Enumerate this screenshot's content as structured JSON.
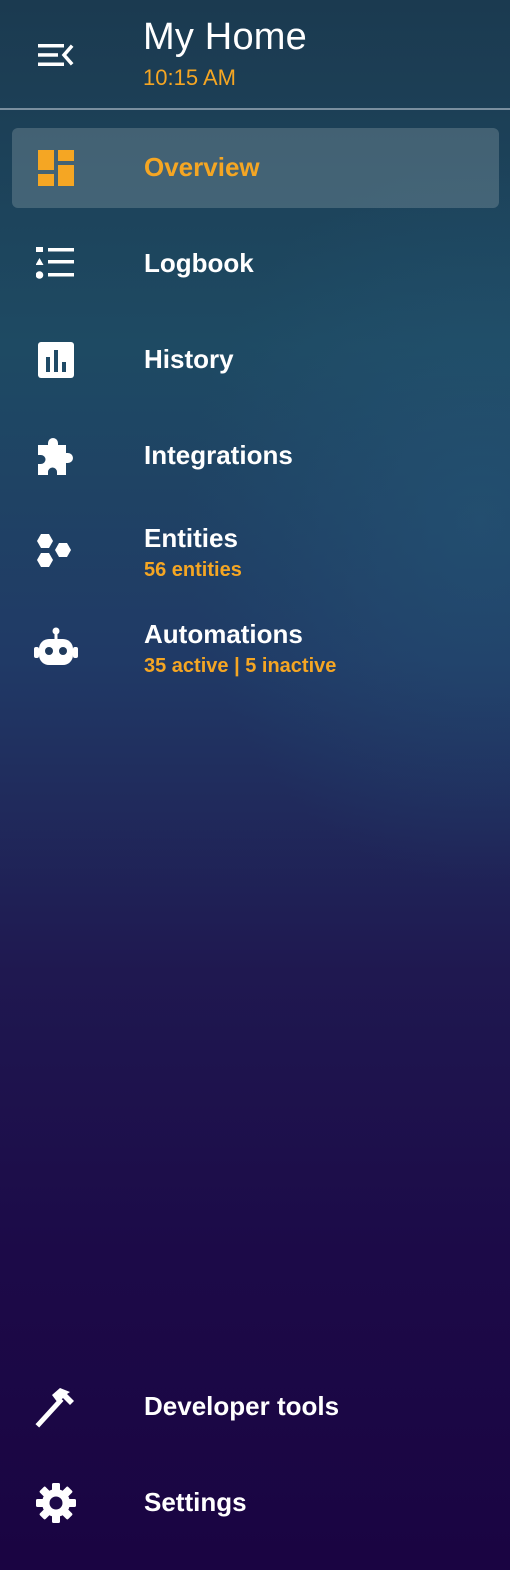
{
  "colors": {
    "accent": "#f5a623",
    "text": "#ffffff",
    "active_bg": "#5d7582"
  },
  "header": {
    "title": "My Home",
    "time": "10:15 AM",
    "menu_icon": "menu-collapse-icon"
  },
  "nav": {
    "items": [
      {
        "label": "Overview",
        "icon": "dashboard-icon",
        "active": true
      },
      {
        "label": "Logbook",
        "icon": "logbook-icon"
      },
      {
        "label": "History",
        "icon": "chart-bar-icon"
      },
      {
        "label": "Integrations",
        "icon": "puzzle-icon"
      },
      {
        "label": "Entities",
        "sub": "56 entities",
        "icon": "hexagons-icon"
      },
      {
        "label": "Automations",
        "sub": "35 active | 5 inactive",
        "icon": "robot-icon"
      }
    ],
    "bottom": [
      {
        "label": "Developer tools",
        "icon": "hammer-icon"
      },
      {
        "label": "Settings",
        "icon": "gear-icon"
      }
    ]
  }
}
